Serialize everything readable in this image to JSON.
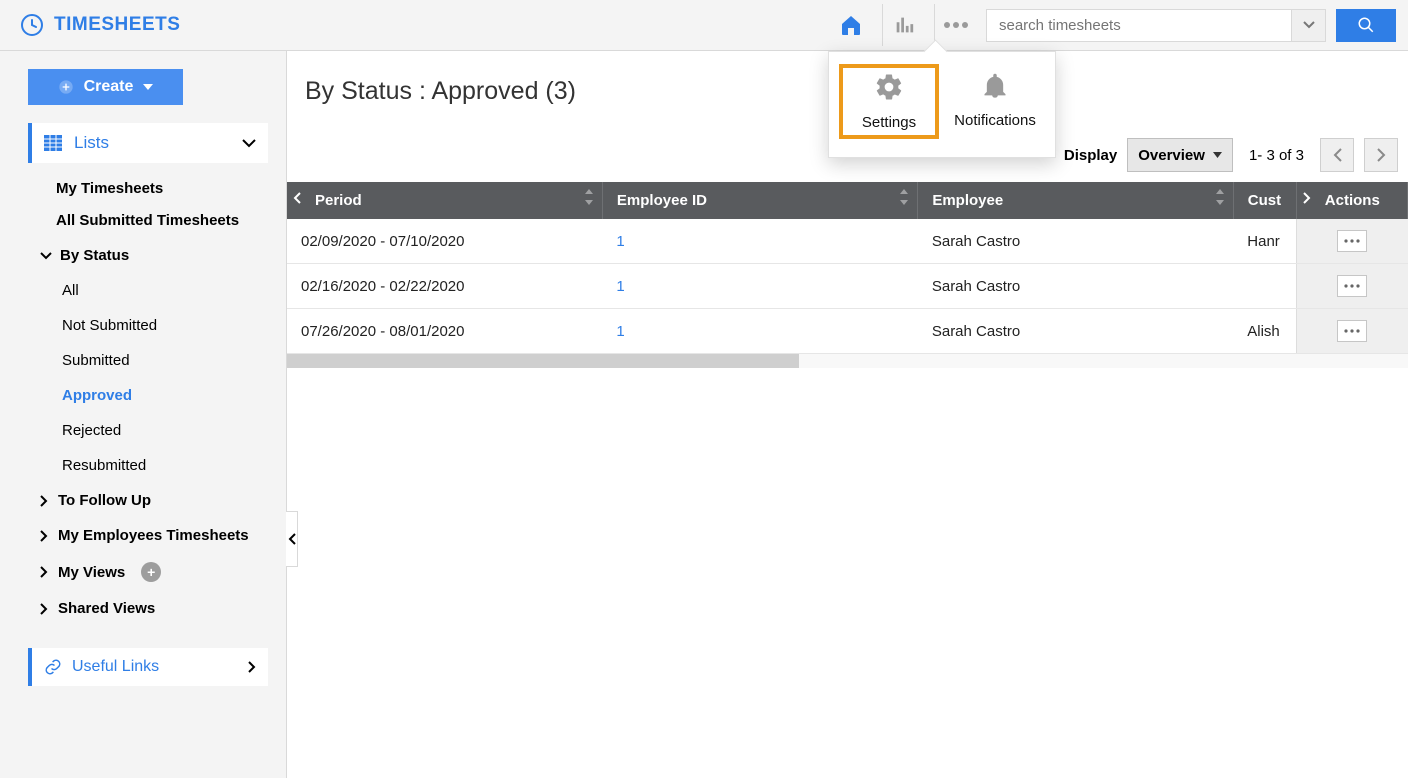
{
  "brand": "TIMESHEETS",
  "search": {
    "placeholder": "search timesheets"
  },
  "popover": {
    "settings": "Settings",
    "notifications": "Notifications"
  },
  "sidebar": {
    "create": "Create",
    "lists_label": "Lists",
    "items": {
      "my_timesheets": "My Timesheets",
      "all_submitted": "All Submitted Timesheets",
      "by_status": "By Status",
      "status": {
        "all": "All",
        "not_submitted": "Not Submitted",
        "submitted": "Submitted",
        "approved": "Approved",
        "rejected": "Rejected",
        "resubmitted": "Resubmitted"
      },
      "to_follow_up": "To Follow Up",
      "my_employees": "My Employees Timesheets",
      "my_views": "My Views",
      "shared_views": "Shared Views"
    },
    "useful_links": "Useful Links"
  },
  "page": {
    "title": "By Status : Approved (3)"
  },
  "toolbar": {
    "display_label": "Display",
    "display_value": "Overview",
    "pager": "1- 3 of 3"
  },
  "table": {
    "headers": {
      "period": "Period",
      "employee_id": "Employee ID",
      "employee": "Employee",
      "customer": "Cust",
      "actions": "Actions"
    },
    "rows": [
      {
        "period": "02/09/2020 - 07/10/2020",
        "employee_id": "1",
        "employee": "Sarah Castro",
        "customer": "Hanr"
      },
      {
        "period": "02/16/2020 - 02/22/2020",
        "employee_id": "1",
        "employee": "Sarah Castro",
        "customer": ""
      },
      {
        "period": "07/26/2020 - 08/01/2020",
        "employee_id": "1",
        "employee": "Sarah Castro",
        "customer": "Alish"
      }
    ]
  }
}
